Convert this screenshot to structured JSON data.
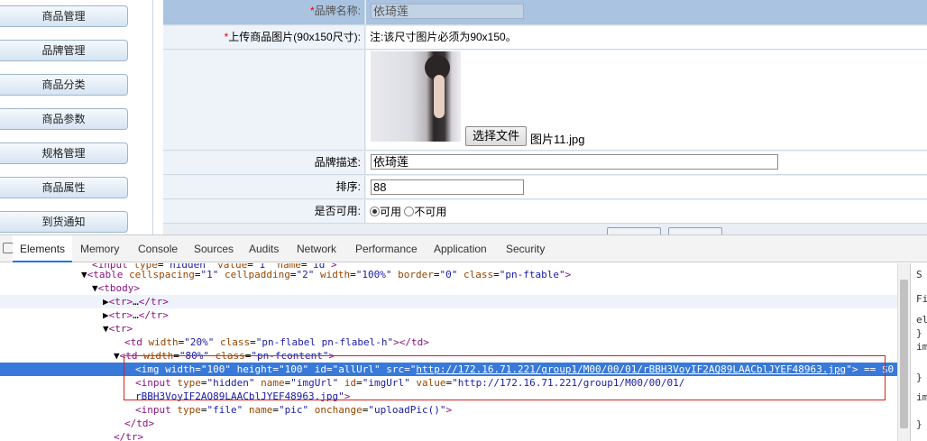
{
  "sidebar": {
    "items": [
      {
        "label": "商品管理"
      },
      {
        "label": "品牌管理"
      },
      {
        "label": "商品分类"
      },
      {
        "label": "商品参数"
      },
      {
        "label": "规格管理"
      },
      {
        "label": "商品属性"
      },
      {
        "label": "到货通知"
      }
    ]
  },
  "form": {
    "brand_name_label": "品牌名称:",
    "brand_name_value": "依琦莲",
    "upload_label": "上传商品图片(90x150尺寸):",
    "upload_note": "注:该尺寸图片必须为90x150。",
    "file_button": "选择文件",
    "file_name": "图片11.jpg",
    "desc_label": "品牌描述:",
    "desc_value": "依琦莲",
    "sort_label": "排序:",
    "sort_value": "88",
    "enabled_label": "是否可用:",
    "opt_yes": "可用",
    "opt_no": "不可用",
    "required_mark": "*"
  },
  "devtools": {
    "tabs": [
      "Elements",
      "Memory",
      "Console",
      "Sources",
      "Audits",
      "Network",
      "Performance",
      "Application",
      "Security"
    ],
    "right_pane": [
      "S",
      "Fil",
      "el",
      "}",
      "im",
      "}",
      "im",
      "}"
    ]
  }
}
